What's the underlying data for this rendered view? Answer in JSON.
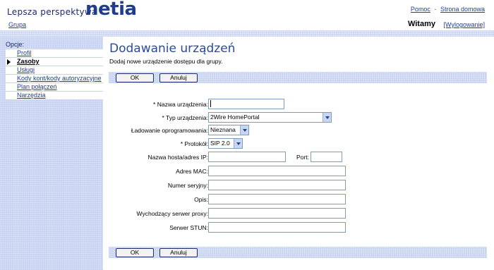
{
  "header": {
    "tagline": "Lepsza perspektywa",
    "logo": "netia",
    "help_link": "Pomoc",
    "separator": "-",
    "home_link": "Strona domowa",
    "group_link": "Grupa",
    "welcome": "Witamy",
    "logout": "[Wylogowanie]"
  },
  "sidebar": {
    "title": "Opcje:",
    "items": [
      {
        "label": "Profil",
        "active": false
      },
      {
        "label": "Zasoby",
        "active": true
      },
      {
        "label": "Usługi",
        "active": false
      },
      {
        "label": "Kody kont/kody autoryzacyjne",
        "active": false
      },
      {
        "label": "Plan połączeń",
        "active": false
      },
      {
        "label": "Narzędzia",
        "active": false
      }
    ]
  },
  "main": {
    "title": "Dodawanie urządzeń",
    "subtitle": "Dodaj nowe urządzenie dostępu dla grupy.",
    "ok_label": "OK",
    "cancel_label": "Anuluj"
  },
  "form": {
    "device_name_label": "* Nazwa urządzenia:",
    "device_name_value": "",
    "device_type_label": "* Typ urządzenia:",
    "device_type_value": "2Wire HomePortal",
    "firmware_label": "Ładowanie oprogramowania:",
    "firmware_value": "Nieznana",
    "protocol_label": "* Protokół:",
    "protocol_value": "SIP 2.0",
    "host_label": "Nazwa hosta/adres IP:",
    "host_value": "",
    "port_label": "Port:",
    "port_value": "",
    "mac_label": "Adres MAC:",
    "mac_value": "",
    "serial_label": "Numer seryjny:",
    "serial_value": "",
    "description_label": "Opis:",
    "description_value": "",
    "proxy_label": "Wychodzący serwer proxy:",
    "proxy_value": "",
    "stun_label": "Serwer STUN:",
    "stun_value": ""
  },
  "colors": {
    "brand": "#1f3d8c",
    "link": "#1a3fa0",
    "title": "#2a4a9a",
    "band": "#c3cff0"
  }
}
